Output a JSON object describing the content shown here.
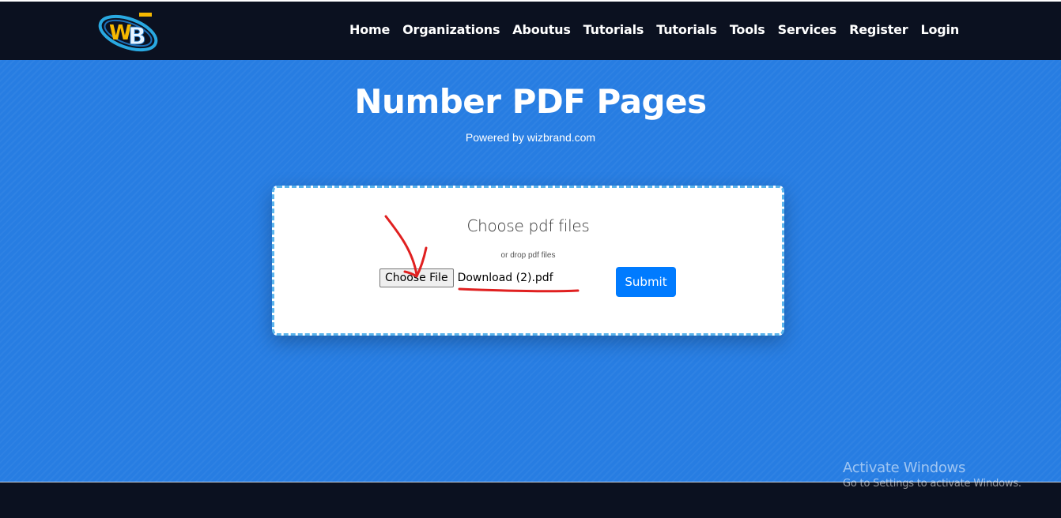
{
  "header": {
    "logo_icon": "wb-logo-icon",
    "nav": [
      {
        "label": "Home"
      },
      {
        "label": "Organizations"
      },
      {
        "label": "Aboutus"
      },
      {
        "label": "Tutorials"
      },
      {
        "label": "Tutorials"
      },
      {
        "label": "Tools"
      },
      {
        "label": "Services"
      },
      {
        "label": "Register"
      },
      {
        "label": "Login"
      }
    ]
  },
  "hero": {
    "title": "Number PDF Pages",
    "subtitle": "Powered by wizbrand.com",
    "background_color": "#277de2"
  },
  "upload": {
    "heading": "Choose pdf files",
    "subheading": "or drop pdf files",
    "choose_button_label": "Choose File",
    "selected_file": "Download (2).pdf",
    "submit_label": "Submit",
    "border_color": "#5ab4ec",
    "submit_color": "#007bff"
  },
  "annotation": {
    "arrow_color": "#e02020",
    "arrow_icon": "arrow-annotation-icon"
  },
  "watermark": {
    "title": "Activate Windows",
    "subtitle": "Go to Settings to activate Windows."
  }
}
